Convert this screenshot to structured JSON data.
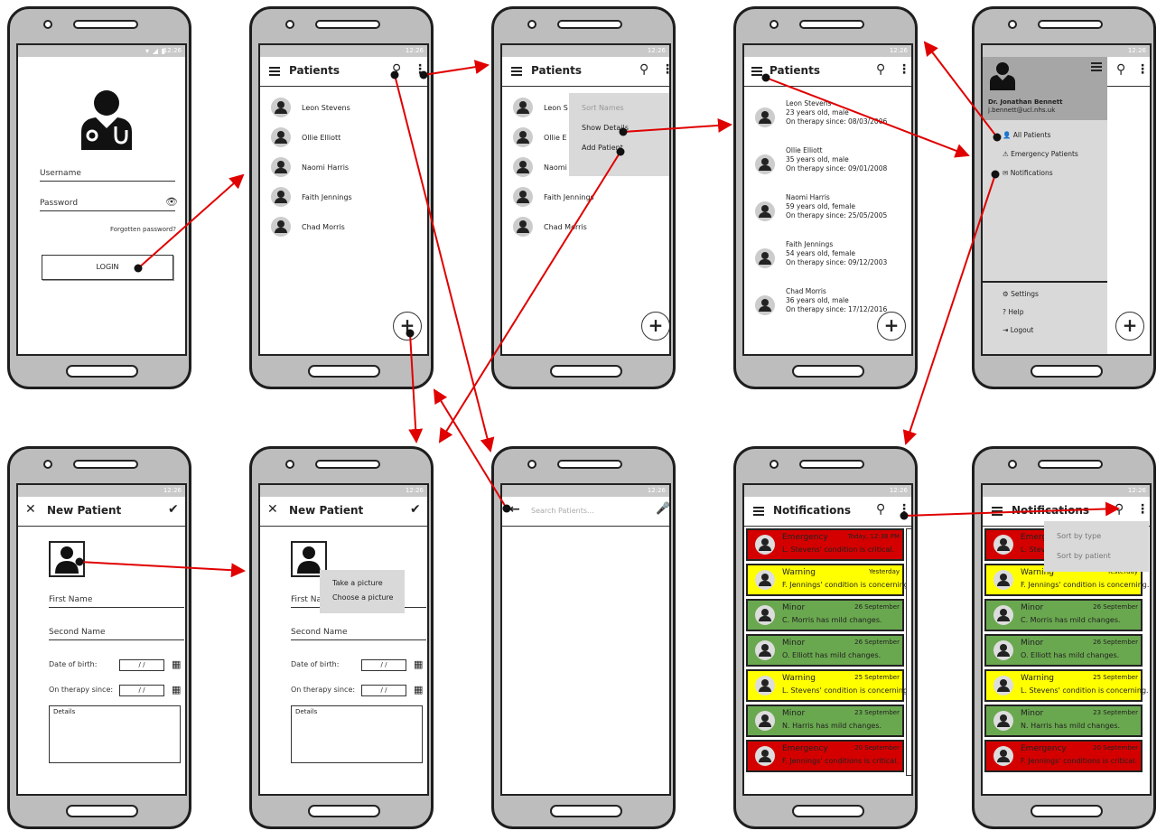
{
  "status": {
    "time": "12:26"
  },
  "login": {
    "username_label": "Username",
    "password_label": "Password",
    "forgot": "Forgotten password?",
    "login_button": "LOGIN"
  },
  "patients_title": "Patients",
  "patients": [
    "Leon Stevens",
    "Ollie Elliott",
    "Naomi Harris",
    "Faith Jennings",
    "Chad Morris"
  ],
  "patients_menu_screen": [
    "Leon S",
    "Ollie E",
    "Naomi",
    "Faith Jennings",
    "Chad Morris"
  ],
  "options_menu": {
    "sort": "Sort Names",
    "details": "Show Details",
    "add": "Add Patient"
  },
  "patient_details": [
    {
      "name": "Leon Stevens",
      "info": "23 years old, male",
      "since": "On therapy since: 08/03/2006"
    },
    {
      "name": "Ollie Elliott",
      "info": "35 years old, male",
      "since": "On therapy since: 09/01/2008"
    },
    {
      "name": "Naomi Harris",
      "info": "59 years old, female",
      "since": "On therapy since: 25/05/2005"
    },
    {
      "name": "Faith Jennings",
      "info": "54 years old, female",
      "since": "On therapy since: 09/12/2003"
    },
    {
      "name": "Chad Morris",
      "info": "36 years old, male",
      "since": "On therapy since: 17/12/2016"
    }
  ],
  "drawer": {
    "doctor": "Dr. Jonathan Bennett",
    "email": "j.bennett@ucl.nhs.uk",
    "all_patients": "All Patients",
    "emergency": "Emergency Patients",
    "notifications": "Notifications",
    "settings": "Settings",
    "help": "Help",
    "logout": "Logout"
  },
  "new_patient": {
    "title": "New Patient",
    "first_name": "First Name",
    "second_name": "Second Name",
    "dob": "Date of birth:",
    "therapy": "On therapy since:",
    "date_placeholder": "/ /",
    "details": "Details"
  },
  "new_patient_2": {
    "first_name_partial": "First Na"
  },
  "picture_menu": {
    "take": "Take a picture",
    "choose": "Choose a picture"
  },
  "search": {
    "placeholder": "Search Patients..."
  },
  "notifications_title": "Notifications",
  "notifications": [
    {
      "type": "Emergency",
      "date": "Today, 12:38 PM",
      "msg": "L. Stevens' condition is critical.",
      "color": "#d40000"
    },
    {
      "type": "Warning",
      "date": "Yesterday",
      "msg": "F. Jennings' condition is concerning.",
      "color": "#ffff00"
    },
    {
      "type": "Minor",
      "date": "26 September",
      "msg": "C. Morris has mild changes.",
      "color": "#6aa84f"
    },
    {
      "type": "Minor",
      "date": "26 September",
      "msg": "O. Elliott has mild changes.",
      "color": "#6aa84f"
    },
    {
      "type": "Warning",
      "date": "25 September",
      "msg": "L. Stevens' condition is concerning.",
      "color": "#ffff00"
    },
    {
      "type": "Minor",
      "date": "23 September",
      "msg": "N. Harris has mild changes.",
      "color": "#6aa84f"
    },
    {
      "type": "Emergency",
      "date": "20 September",
      "msg": "F. Jennings' conditions is critical.",
      "color": "#d40000"
    }
  ],
  "notif_menu": {
    "by_type": "Sort by type",
    "by_patient": "Sort by patient"
  },
  "colors": {
    "arrow": "#e00000",
    "phone": "#bdbdbd",
    "menu": "#d9d9d9",
    "drawer_header": "#a6a6a6"
  }
}
